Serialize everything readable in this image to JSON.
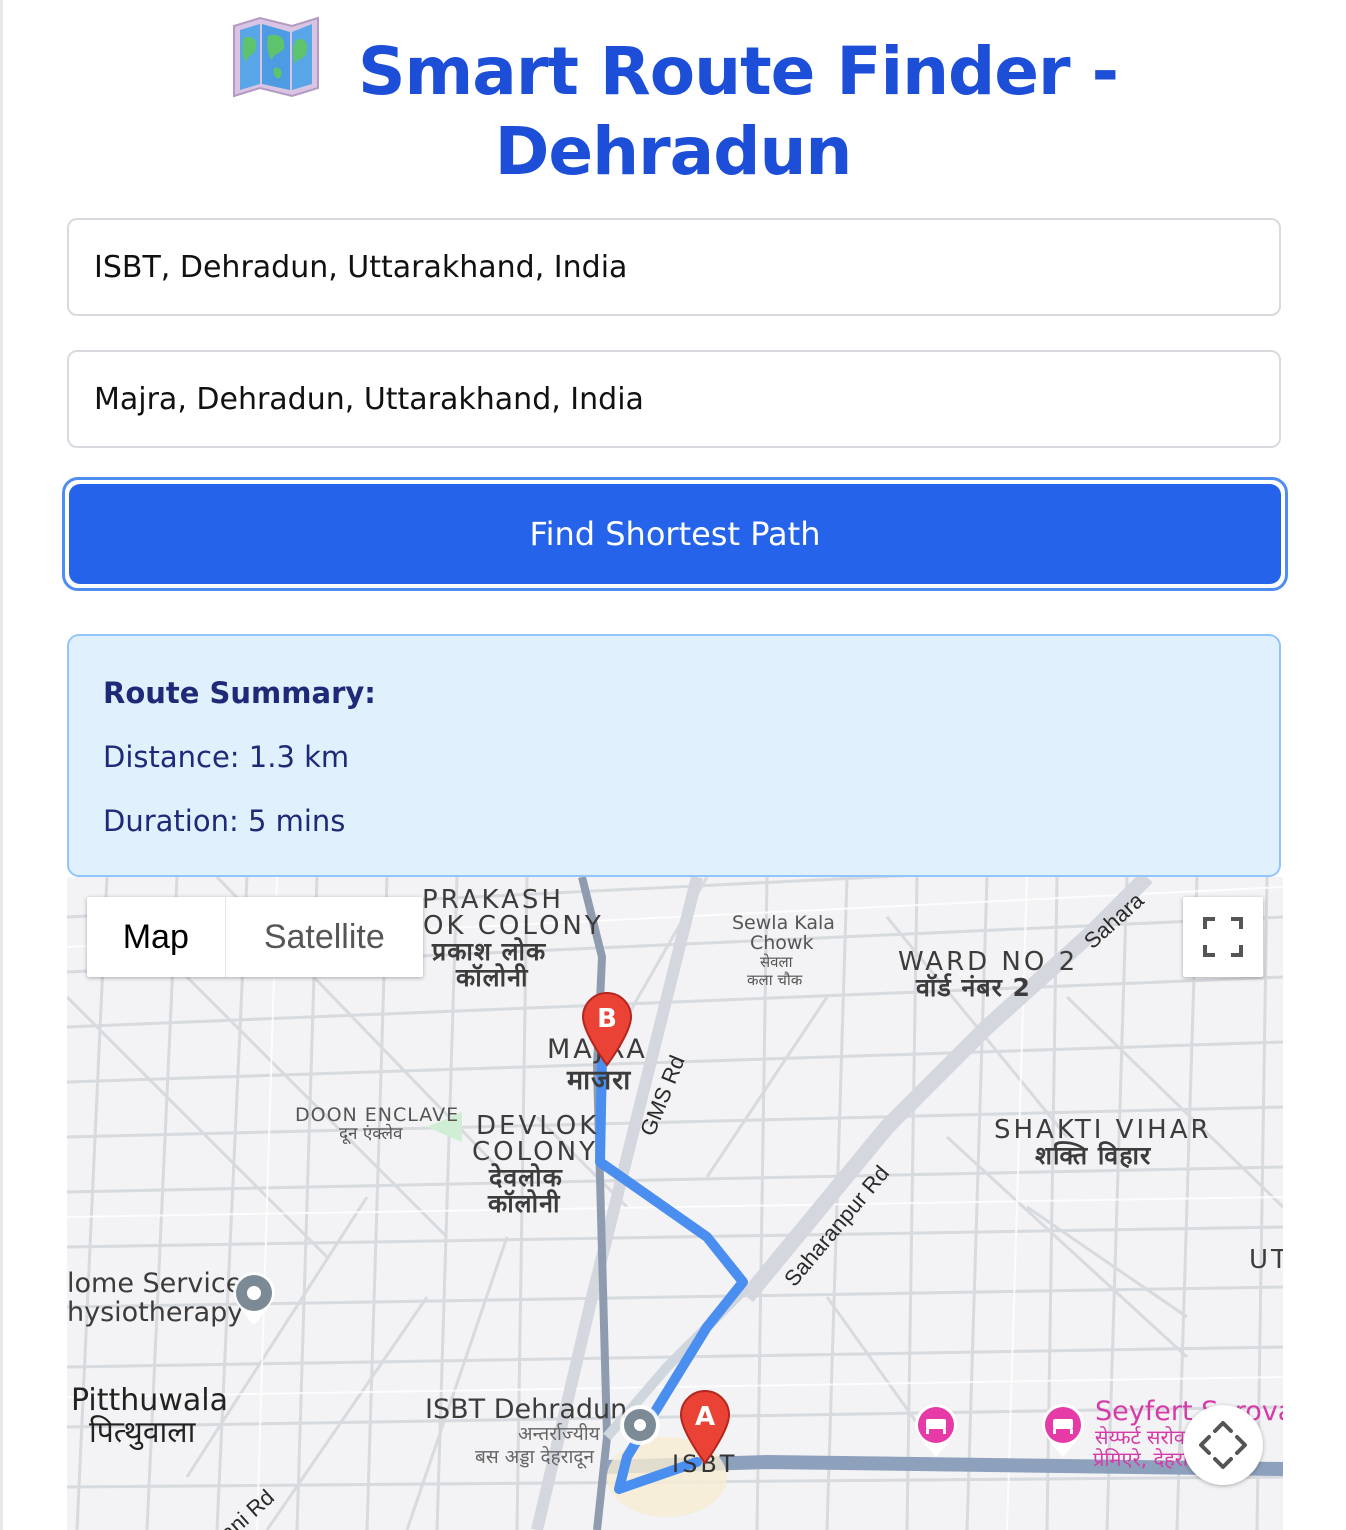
{
  "header": {
    "title_line1": "Smart Route Finder -",
    "title_line2": "Dehradun",
    "icon": "world-map-icon"
  },
  "form": {
    "from_value": "ISBT, Dehradun, Uttarakhand, India",
    "to_value": "Majra, Dehradun, Uttarakhand, India",
    "submit_label": "Find Shortest Path"
  },
  "summary": {
    "title": "Route Summary:",
    "distance": "Distance: 1.3 km",
    "duration": "Duration: 5 mins"
  },
  "map": {
    "type_controls": {
      "map_label": "Map",
      "satellite_label": "Satellite",
      "selected": "Map"
    },
    "markers": {
      "start_letter": "A",
      "end_letter": "B"
    },
    "labels": {
      "prakash_1": "PRAKASH",
      "prakash_2": "OK COLONY",
      "prakash_hi_1": "प्रकाश लोक",
      "prakash_hi_2": "कॉलोनी",
      "sewla_1": "Sewla Kala",
      "sewla_2": "Chowk",
      "sewla_hi_1": "सेवला",
      "sewla_hi_2": "कला चौक",
      "ward_1": "WARD NO 2",
      "ward_hi": "वॉर्ड नंबर 2",
      "majra": "MAJRA",
      "majra_hi": "माजरा",
      "doon_1": "DOON ENCLAVE",
      "doon_hi": "दून एंक्लेव",
      "devlok_1": "DEVLOK",
      "devlok_2": "COLONY",
      "devlok_hi_1": "देवलोक",
      "devlok_hi_2": "कॉलोनी",
      "shakti_1": "SHAKTI VIHAR",
      "shakti_hi": "शक्ति विहार",
      "ut": "UT",
      "physio_1": "lome Service",
      "physio_2": "hysiotherapy",
      "pitthuwala": "Pitthuwala",
      "pitthuwala_hi": "पित्थुवाला",
      "isbt_poi": "ISBT Dehradun",
      "isbt_poi_hi_1": "अन्तर्राज्यीय",
      "isbt_poi_hi_2": "बस अड्डा देहरादून",
      "isbt": "ISBT",
      "hotel_1": "Seyfert Sarovar",
      "hotel_hi_1": "सेय्फर्ट सरोवर",
      "hotel_hi_2": "प्रेमिएरे, देहरादून",
      "road_gms": "GMS Rd",
      "road_saharanpur": "Saharanpur Rd",
      "road_saharanpur_2": "Saharanpur Rd",
      "road_sw": "ani Rd",
      "road_top_right": "Sahara"
    }
  },
  "colors": {
    "title": "#1d4ed8",
    "button": "#2563eb",
    "summary_bg": "#e0f0fd",
    "summary_border": "#93c5fd",
    "summary_text": "#1e2a78",
    "route": "#4a8ef0",
    "marker": "#ea4335",
    "hotel": "#d63aa8"
  }
}
